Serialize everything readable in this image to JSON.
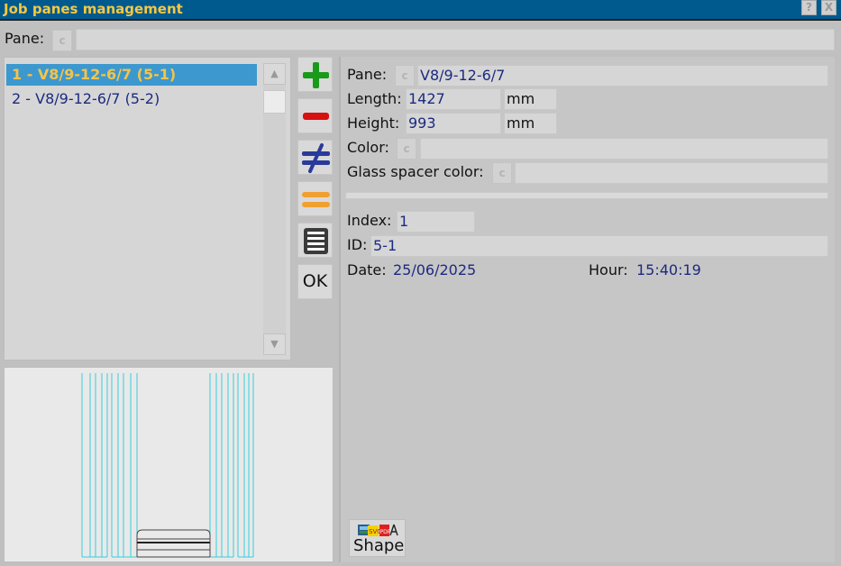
{
  "window": {
    "title": "Job panes management",
    "help_label": "?",
    "close_label": "X"
  },
  "search": {
    "pane_label": "Pane:",
    "c_label": "c",
    "value": ""
  },
  "list": {
    "items": [
      {
        "label": "1 - V8/9-12-6/7 (5-1)"
      },
      {
        "label": "2 - V8/9-12-6/7 (5-2)"
      }
    ],
    "selected_index": 0
  },
  "toolbar": {
    "ok_label": "OK",
    "add_color": "#1a9a1a",
    "remove_color": "#d81010",
    "diff_color": "#2a3a9a",
    "equal_color": "#f0a030"
  },
  "details": {
    "pane_label": "Pane:",
    "pane_value": "V8/9-12-6/7",
    "length_label": "Length:",
    "length_value": "1427",
    "length_unit": "mm",
    "height_label": "Height:",
    "height_value": "993",
    "height_unit": "mm",
    "color_label": "Color:",
    "color_value": "",
    "spacer_label": "Glass spacer color:",
    "spacer_value": "",
    "index_label": "Index:",
    "index_value": "1",
    "id_label": "ID:",
    "id_value": "5-1",
    "date_label": "Date:",
    "date_value": "25/06/2025",
    "hour_label": "Hour:",
    "hour_value": "15:40:19",
    "c_label": "c"
  },
  "shape_button": {
    "label": "Shape",
    "svg_badge": "SVG",
    "pdf_badge": "PDF"
  }
}
